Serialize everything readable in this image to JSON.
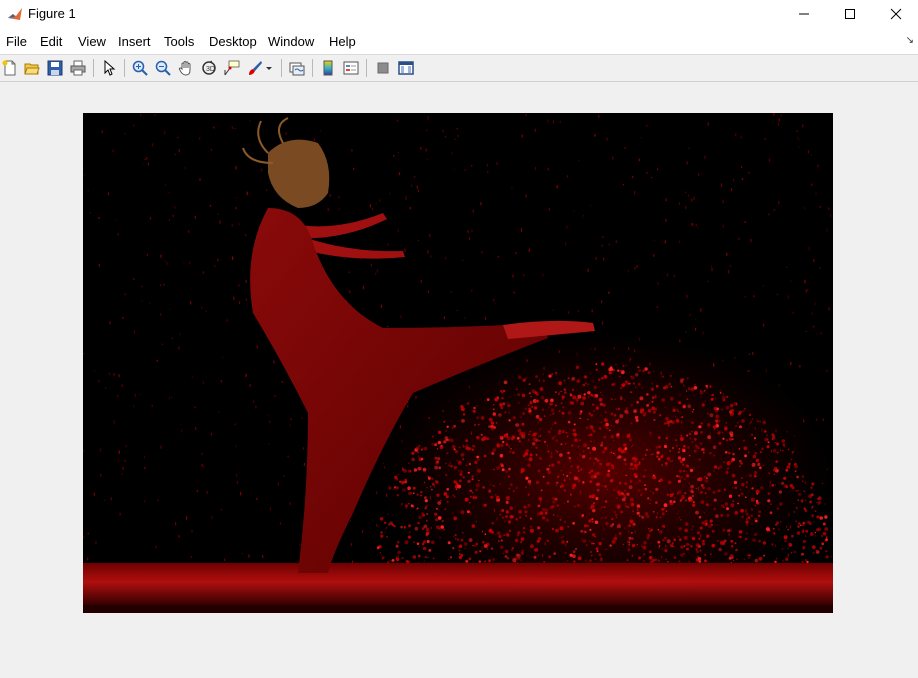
{
  "window": {
    "title": "Figure 1",
    "controls": {
      "minimize": "—",
      "maximize": "☐",
      "close": "✕"
    }
  },
  "menu": {
    "items": [
      {
        "label": "File",
        "mnemonic": "F"
      },
      {
        "label": "Edit",
        "mnemonic": "E"
      },
      {
        "label": "View",
        "mnemonic": "V"
      },
      {
        "label": "Insert",
        "mnemonic": "I"
      },
      {
        "label": "Tools",
        "mnemonic": "T"
      },
      {
        "label": "Desktop",
        "mnemonic": "D"
      },
      {
        "label": "Window",
        "mnemonic": "W"
      },
      {
        "label": "Help",
        "mnemonic": "H"
      }
    ]
  },
  "toolbar": {
    "buttons": [
      "new-figure-icon",
      "open-file-icon",
      "save-icon",
      "print-icon",
      "select-arrow-icon",
      "zoom-in-icon",
      "zoom-out-icon",
      "pan-hand-icon",
      "rotate-3d-icon",
      "data-cursor-icon",
      "brush-icon",
      "link-plot-icon",
      "insert-colorbar-icon",
      "insert-legend-icon",
      "hide-plot-tools-icon",
      "show-plot-tools-icon"
    ]
  },
  "figure": {
    "content": "Red-tinted photograph of a dancer in a dress kicking up water splashes against a black background",
    "dominant_color": "#c00000",
    "background_color": "#000000"
  },
  "colors": {
    "window_bg": "#f0f0f0",
    "titlebar_bg": "#ffffff"
  }
}
